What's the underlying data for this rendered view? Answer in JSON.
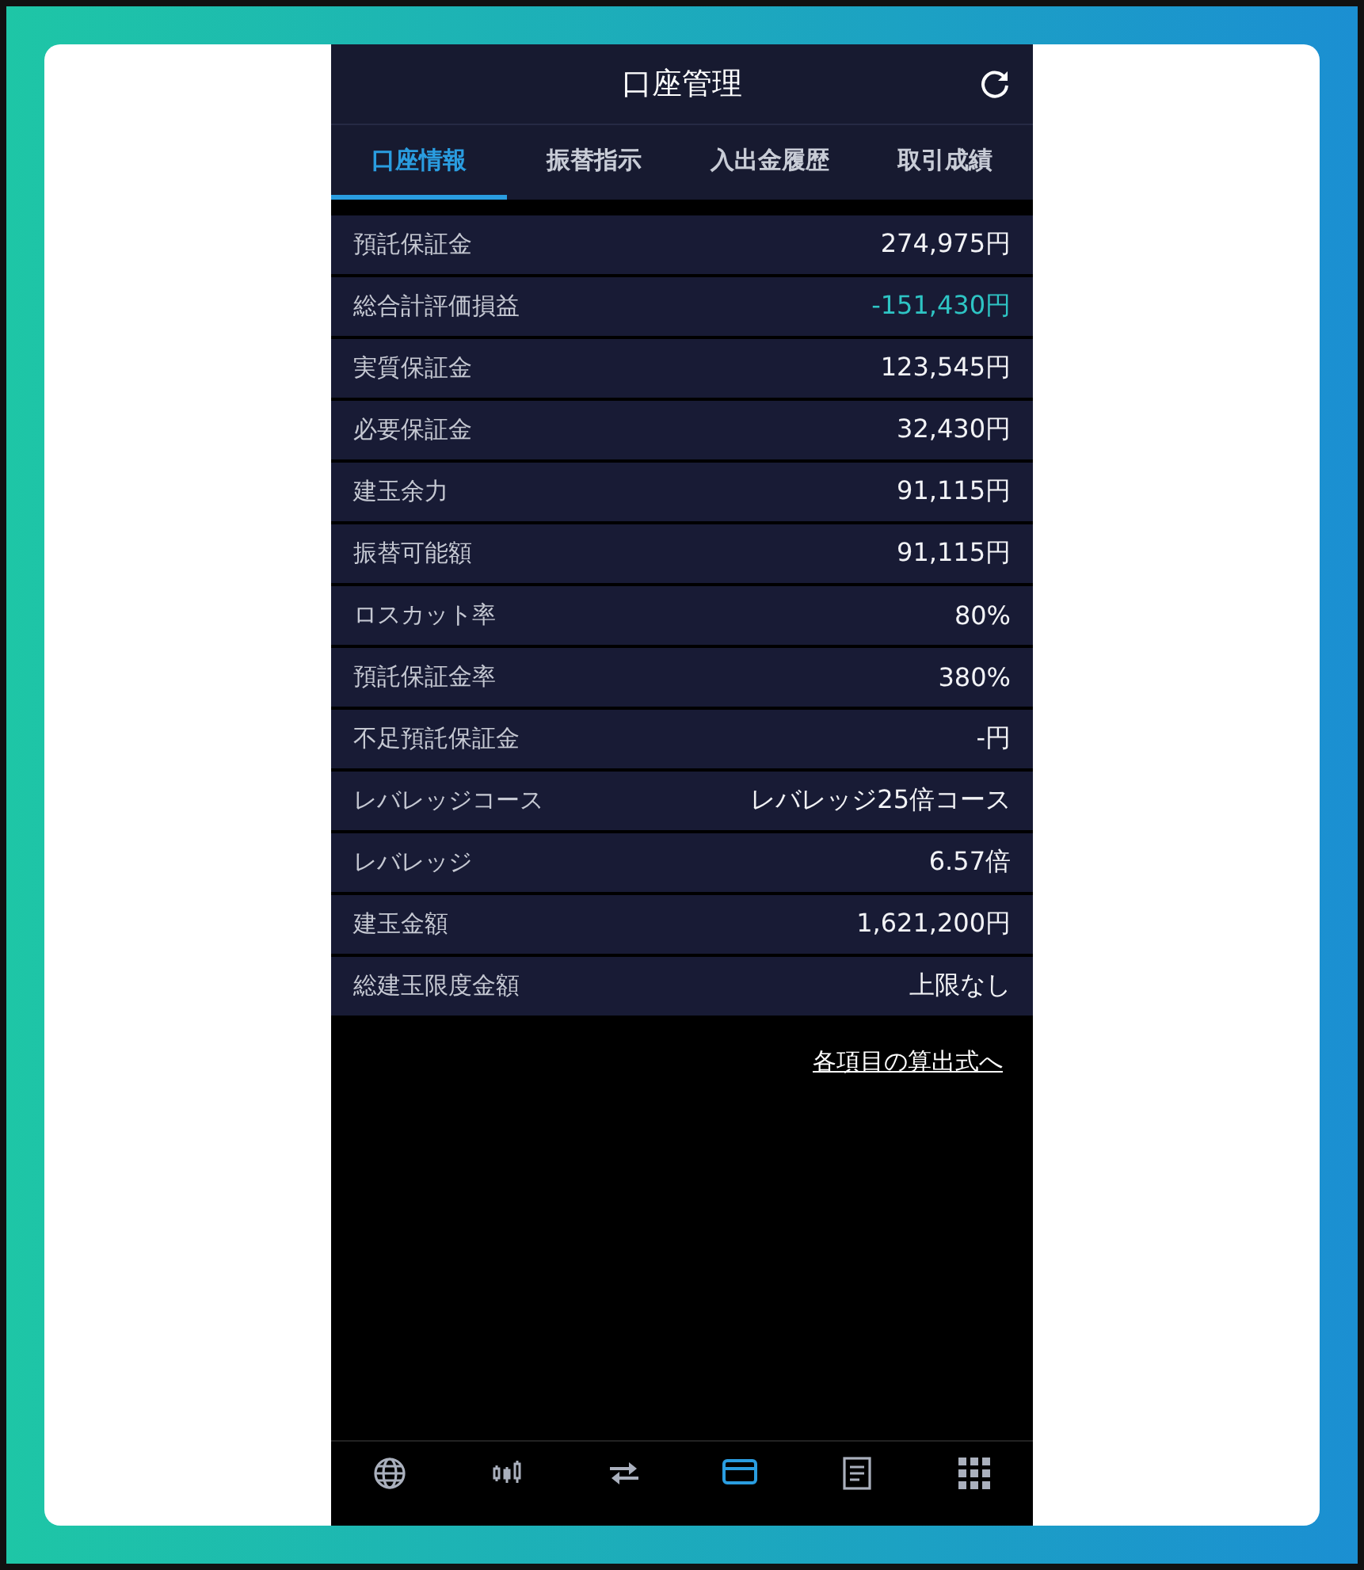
{
  "header": {
    "title": "口座管理"
  },
  "tabs": [
    {
      "label": "口座情報",
      "selected": true
    },
    {
      "label": "振替指示",
      "selected": false
    },
    {
      "label": "入出金履歴",
      "selected": false
    },
    {
      "label": "取引成績",
      "selected": false
    }
  ],
  "rows": [
    {
      "label": "預託保証金",
      "value": "274,975円",
      "kind": "normal"
    },
    {
      "label": "総合計評価損益",
      "value": "-151,430円",
      "kind": "negative"
    },
    {
      "label": "実質保証金",
      "value": "123,545円",
      "kind": "normal"
    },
    {
      "label": "必要保証金",
      "value": "32,430円",
      "kind": "normal"
    },
    {
      "label": "建玉余力",
      "value": "91,115円",
      "kind": "normal"
    },
    {
      "label": "振替可能額",
      "value": "91,115円",
      "kind": "normal"
    },
    {
      "label": "ロスカット率",
      "value": "80%",
      "kind": "normal"
    },
    {
      "label": "預託保証金率",
      "value": "380%",
      "kind": "normal"
    },
    {
      "label": "不足預託保証金",
      "value": "-円",
      "kind": "normal"
    },
    {
      "label": "レバレッジコース",
      "value": "レバレッジ25倍コース",
      "kind": "normal"
    },
    {
      "label": "レバレッジ",
      "value": "6.57倍",
      "kind": "normal"
    },
    {
      "label": "建玉金額",
      "value": "1,621,200円",
      "kind": "normal"
    },
    {
      "label": "総建玉限度金額",
      "value": "上限なし",
      "kind": "normal"
    }
  ],
  "link": "各項目の算出式へ",
  "nav": [
    {
      "kind": "globe",
      "selected": false
    },
    {
      "kind": "candles",
      "selected": false
    },
    {
      "kind": "arrows",
      "selected": false
    },
    {
      "kind": "card",
      "selected": true
    },
    {
      "kind": "document",
      "selected": false
    },
    {
      "kind": "grid",
      "selected": false
    }
  ]
}
